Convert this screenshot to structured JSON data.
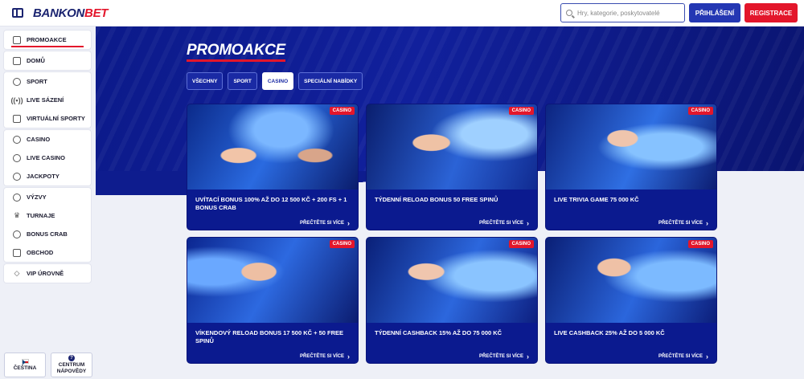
{
  "header": {
    "logo_main": "BANKON",
    "logo_accent": "BET",
    "search_placeholder": "Hry, kategorie, poskytovatelé",
    "login_label": "PŘIHLÁŠENÍ",
    "register_label": "REGISTRACE"
  },
  "sidebar": {
    "groups": [
      [
        {
          "label": "PROMOAKCE",
          "icon": "gift-icon"
        }
      ],
      [
        {
          "label": "DOMŮ",
          "icon": "home-icon"
        }
      ],
      [
        {
          "label": "SPORT",
          "icon": "ball-icon"
        },
        {
          "label": "LIVE SÁZENÍ",
          "icon": "live-icon"
        },
        {
          "label": "VIRTUÁLNÍ SPORTY",
          "icon": "virtual-icon"
        }
      ],
      [
        {
          "label": "CASINO",
          "icon": "chip-icon"
        },
        {
          "label": "LIVE CASINO",
          "icon": "live-casino-icon"
        },
        {
          "label": "JACKPOTY",
          "icon": "jackpot-icon"
        }
      ],
      [
        {
          "label": "VÝZVY",
          "icon": "medal-icon"
        },
        {
          "label": "TURNAJE",
          "icon": "trophy-icon"
        },
        {
          "label": "BONUS CRAB",
          "icon": "crab-icon"
        },
        {
          "label": "OBCHOD",
          "icon": "shop-icon"
        }
      ],
      [
        {
          "label": "VIP ÚROVNĚ",
          "icon": "diamond-icon"
        }
      ]
    ],
    "language_label": "ČEŠTINA",
    "help_label_1": "CENTRUM",
    "help_label_2": "NÁPOVĚDY"
  },
  "main": {
    "title": "PROMOAKCE",
    "filters": [
      "VŠECHNY",
      "SPORT",
      "CASINO",
      "SPECIÁLNÍ NABÍDKY"
    ],
    "active_filter": "CASINO",
    "read_more": "PŘEČTĚTE SI VÍCE",
    "cards": [
      {
        "badge": "CASINO",
        "title": "UVÍTACÍ BONUS 100% AŽ DO 12 500 KČ + 200 FS + 1 BONUS CRAB"
      },
      {
        "badge": "CASINO",
        "title": "TÝDENNÍ RELOAD BONUS 50 FREE SPINŮ"
      },
      {
        "badge": "CASINO",
        "title": "LIVE TRIVIA GAME 75 000 KČ"
      },
      {
        "badge": "CASINO",
        "title": "VÍKENDOVÝ RELOAD BONUS 17 500 KČ + 50 FREE SPINŮ"
      },
      {
        "badge": "CASINO",
        "title": "TÝDENNÍ CASHBACK 15% AŽ DO 75 000 KČ"
      },
      {
        "badge": "CASINO",
        "title": "LIVE CASHBACK 25% AŽ DO 5 000 KČ"
      }
    ]
  },
  "colors": {
    "brand_blue": "#1b2470",
    "accent_red": "#e3162b",
    "hero_blue": "#11209c"
  }
}
